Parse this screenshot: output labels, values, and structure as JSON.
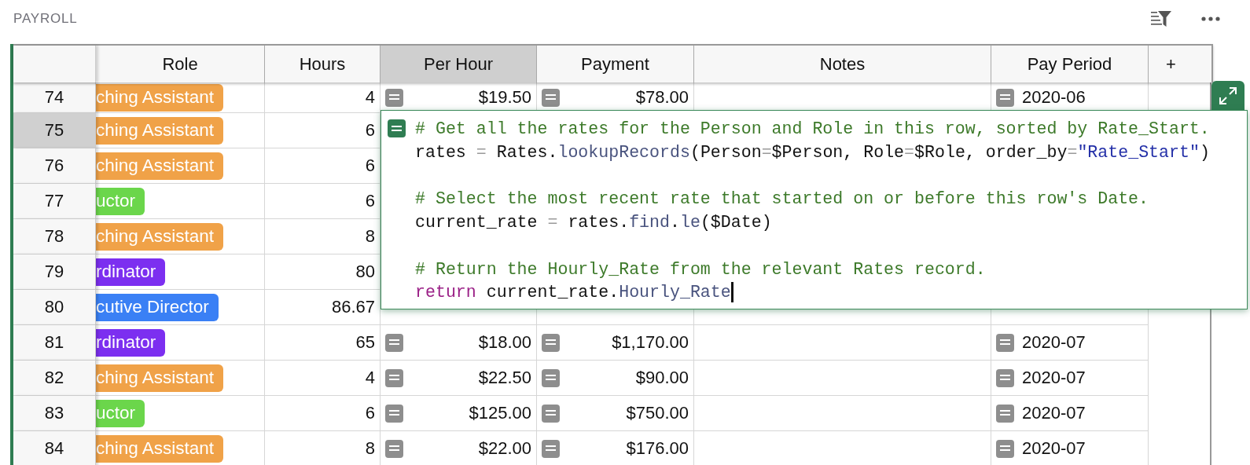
{
  "section": {
    "title": "PAYROLL"
  },
  "toolbar": [
    {
      "kind": "sort-filter"
    },
    {
      "kind": "more"
    }
  ],
  "table": {
    "columns": [
      {
        "label": "Role",
        "selected": false,
        "formula": false
      },
      {
        "label": "Hours",
        "selected": false,
        "formula": false
      },
      {
        "label": "Per Hour",
        "selected": true,
        "formula": true
      },
      {
        "label": "Payment",
        "selected": false,
        "formula": true
      },
      {
        "label": "Notes",
        "selected": false,
        "formula": false
      },
      {
        "label": "Pay Period",
        "selected": false,
        "formula": true
      },
      {
        "label": "+",
        "kind": "add"
      }
    ],
    "rows": [
      {
        "row": "74",
        "selected": false,
        "role": {
          "text": "ching Assistant",
          "color": "#f0a248"
        },
        "hours": "4",
        "per_hour": "$19.50",
        "payment": "$78.00",
        "pay_period": "2020-06"
      },
      {
        "row": "75",
        "selected": true,
        "role": {
          "text": "ching Assistant",
          "color": "#f0a248"
        },
        "hours": "6"
      },
      {
        "row": "76",
        "selected": false,
        "role": {
          "text": "ching Assistant",
          "color": "#f0a248"
        },
        "hours": "6"
      },
      {
        "row": "77",
        "selected": false,
        "role": {
          "text": "uctor",
          "color": "#6bd64b"
        },
        "hours": "6"
      },
      {
        "row": "78",
        "selected": false,
        "role": {
          "text": "ching Assistant",
          "color": "#f0a248"
        },
        "hours": "8"
      },
      {
        "row": "79",
        "selected": false,
        "role": {
          "text": "rdinator",
          "color": "#7c2ff0"
        },
        "hours": "80"
      },
      {
        "row": "80",
        "selected": false,
        "role": {
          "text": "cutive Director",
          "color": "#3a80f5"
        },
        "hours": "86.67"
      },
      {
        "row": "81",
        "selected": false,
        "role": {
          "text": "rdinator",
          "color": "#7c2ff0"
        },
        "hours": "65",
        "per_hour": "$18.00",
        "payment": "$1,170.00",
        "pay_period": "2020-07"
      },
      {
        "row": "82",
        "selected": false,
        "role": {
          "text": "ching Assistant",
          "color": "#f0a248"
        },
        "hours": "4",
        "per_hour": "$22.50",
        "payment": "$90.00",
        "pay_period": "2020-07"
      },
      {
        "row": "83",
        "selected": false,
        "role": {
          "text": "uctor",
          "color": "#6bd64b"
        },
        "hours": "6",
        "per_hour": "$125.00",
        "payment": "$750.00",
        "pay_period": "2020-07"
      },
      {
        "row": "84",
        "selected": false,
        "role": {
          "text": "ching Assistant",
          "color": "#f0a248"
        },
        "hours": "8",
        "per_hour": "$22.00",
        "payment": "$176.00",
        "pay_period": "2020-07"
      }
    ]
  },
  "editor": {
    "cursor_visible": true,
    "lines": [
      {
        "kind": "code",
        "tokens": [
          {
            "kind": "comment",
            "text": "# Get all the rates for the Person and Role in this row, sorted by Rate_Start."
          }
        ]
      },
      {
        "kind": "code",
        "tokens": [
          {
            "kind": "plain",
            "text": "rates "
          },
          {
            "kind": "op",
            "text": "="
          },
          {
            "kind": "plain",
            "text": " Rates."
          },
          {
            "kind": "func",
            "text": "lookupRecords"
          },
          {
            "kind": "plain",
            "text": "(Person"
          },
          {
            "kind": "op",
            "text": "="
          },
          {
            "kind": "plain",
            "text": "$Person, Role"
          },
          {
            "kind": "op",
            "text": "="
          },
          {
            "kind": "plain",
            "text": "$Role, order_by"
          },
          {
            "kind": "op",
            "text": "="
          },
          {
            "kind": "string",
            "text": "\"Rate_Start\""
          },
          {
            "kind": "plain",
            "text": ")"
          }
        ]
      },
      {
        "kind": "blank"
      },
      {
        "kind": "code",
        "tokens": [
          {
            "kind": "comment",
            "text": "# Select the most recent rate that started on or before this row's Date."
          }
        ]
      },
      {
        "kind": "code",
        "tokens": [
          {
            "kind": "plain",
            "text": "current_rate "
          },
          {
            "kind": "op",
            "text": "="
          },
          {
            "kind": "plain",
            "text": " rates."
          },
          {
            "kind": "func",
            "text": "find"
          },
          {
            "kind": "plain",
            "text": "."
          },
          {
            "kind": "func",
            "text": "le"
          },
          {
            "kind": "plain",
            "text": "($Date)"
          }
        ]
      },
      {
        "kind": "blank"
      },
      {
        "kind": "code",
        "tokens": [
          {
            "kind": "comment",
            "text": "# Return the Hourly_Rate from the relevant Rates record."
          }
        ]
      },
      {
        "kind": "code",
        "tokens": [
          {
            "kind": "keyword",
            "text": "return"
          },
          {
            "kind": "plain",
            "text": " current_rate."
          },
          {
            "kind": "func",
            "text": "Hourly_Rate"
          }
        ]
      }
    ]
  }
}
